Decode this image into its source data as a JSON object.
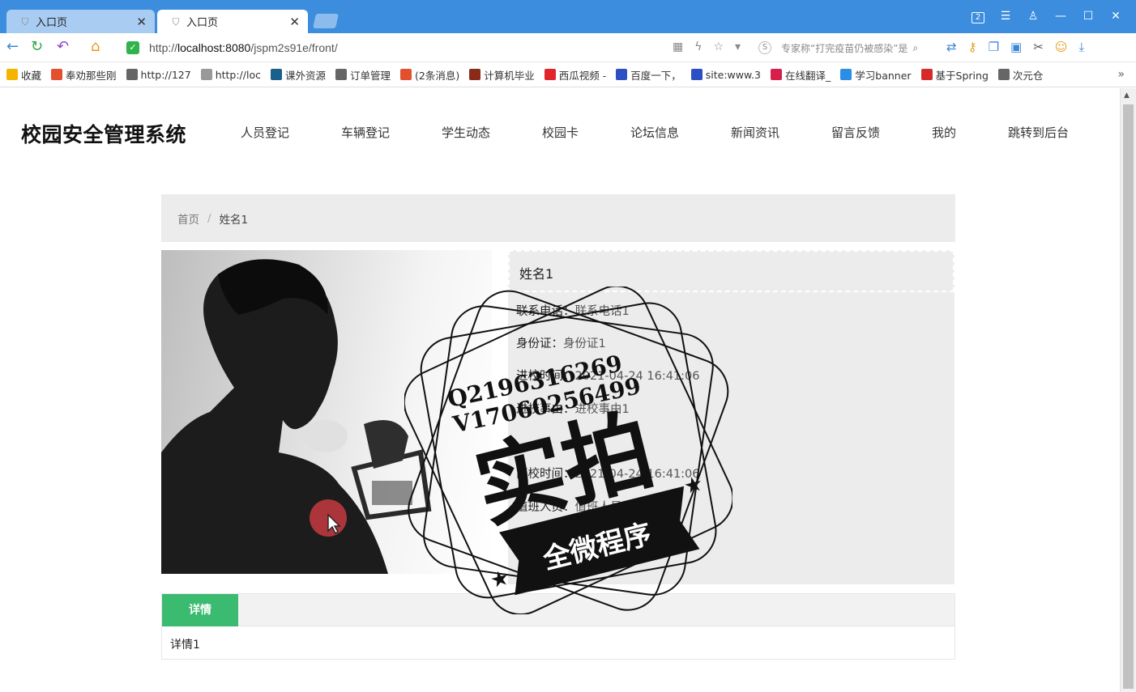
{
  "browser": {
    "tabs": [
      {
        "label": "入口页",
        "active": false
      },
      {
        "label": "入口页",
        "active": true
      }
    ],
    "window_badge": "2",
    "url_prefix": "http://",
    "url_host": "localhost:8080",
    "url_path": "/jspm2s91e/front/",
    "search_placeholder": "专家称“打完疫苗仍被感染”是",
    "bookmarks": [
      {
        "label": "收藏",
        "color": "#f5b400"
      },
      {
        "label": "奉劝那些刚",
        "color": "#e2502f"
      },
      {
        "label": "http://127",
        "color": "#666666"
      },
      {
        "label": "http://loc",
        "color": "#999999"
      },
      {
        "label": "课外资源",
        "color": "#1b5f8c"
      },
      {
        "label": "订单管理",
        "color": "#666666"
      },
      {
        "label": "(2条消息)",
        "color": "#e2502f"
      },
      {
        "label": "计算机毕业",
        "color": "#8a2b1a"
      },
      {
        "label": "西瓜视频 -",
        "color": "#e0262a"
      },
      {
        "label": "百度一下，",
        "color": "#2d4fc4"
      },
      {
        "label": "site:www.3",
        "color": "#2d4fc4"
      },
      {
        "label": "在线翻译_",
        "color": "#d6204b"
      },
      {
        "label": "学习banner",
        "color": "#2a8ee6"
      },
      {
        "label": "基于Spring",
        "color": "#d62a2a"
      },
      {
        "label": "次元仓",
        "color": "#666666"
      }
    ]
  },
  "site": {
    "title": "校园安全管理系统",
    "nav": [
      "人员登记",
      "车辆登记",
      "学生动态",
      "校园卡",
      "论坛信息",
      "新闻资讯",
      "留言反馈",
      "我的",
      "跳转到后台"
    ]
  },
  "breadcrumb": {
    "home": "首页",
    "separator": "/",
    "current": "姓名1"
  },
  "detail": {
    "name": "姓名1",
    "fields": [
      {
        "label": "联系电话：",
        "value": "联系电话1"
      },
      {
        "label": "身份证：",
        "value": "身份证1"
      },
      {
        "label": "进校时间：",
        "value": "2021-04-24 16:41:06"
      },
      {
        "label": "进校事由：",
        "value": "进校事由1"
      },
      {
        "label": "",
        "value": ""
      },
      {
        "label": "离校时间：",
        "value": "2021-04-24 16:41:06"
      },
      {
        "label": "值班人员：",
        "value": "值班人员1"
      },
      {
        "label": "日期：",
        "value": "2021-04-24"
      }
    ]
  },
  "tabs": {
    "active_label": "详情",
    "content": "详情1"
  },
  "watermark": {
    "line1": "Q2196316269",
    "line2": "V17060256499",
    "big": "实拍",
    "ribbon": "全微程序"
  },
  "colors": {
    "accent_green": "#3bbb6f",
    "chrome_blue": "#3c8ddd"
  }
}
